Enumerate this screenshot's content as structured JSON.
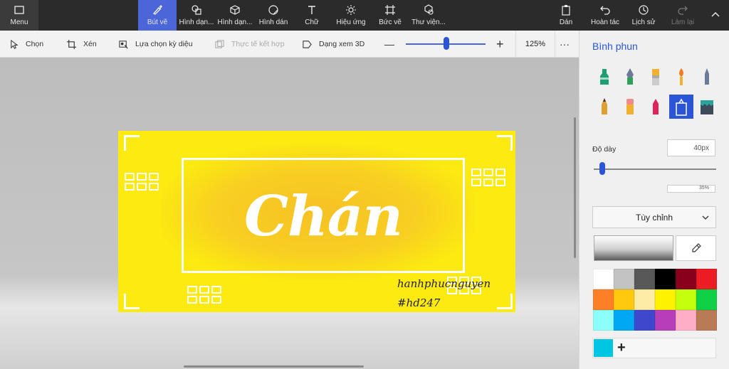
{
  "topbar": {
    "menu_label": "Menu",
    "tools": [
      {
        "label": "Bút vẽ"
      },
      {
        "label": "Hình dạn..."
      },
      {
        "label": "Hình dạn..."
      },
      {
        "label": "Hình dán"
      },
      {
        "label": "Chữ"
      },
      {
        "label": "Hiệu ứng"
      },
      {
        "label": "Bức vẽ"
      },
      {
        "label": "Thư viện..."
      }
    ],
    "paste_label": "Dán",
    "undo_label": "Hoàn tác",
    "history_label": "Lịch sử",
    "redo_label": "Làm lại",
    "active_color": "#4a66d8"
  },
  "toolbar2": {
    "select_label": "Chọn",
    "crop_label": "Xén",
    "magic_select_label": "Lựa chọn kỳ diệu",
    "mixed_reality_label": "Thực tế kết hợp",
    "view3d_label": "Dạng xem 3D",
    "zoom_minus": "—",
    "zoom_plus": "+",
    "zoom_value": "125%",
    "zoom_level_fraction": 0.5,
    "more_label": "···"
  },
  "artwork": {
    "title": "Chán",
    "signature_name": "hanhphucnguyen",
    "signature_tag": "#hd247",
    "background_color": "#fcea10"
  },
  "panel": {
    "title": "Bình phun",
    "brushes": [
      {
        "icon": "marker-icon",
        "color": "#1e9e74"
      },
      {
        "icon": "calligraphy-pen-icon",
        "color": "#2fa05a"
      },
      {
        "icon": "oil-brush-icon",
        "color": "#f0b030"
      },
      {
        "icon": "watercolor-brush-icon",
        "color": "#f07b20"
      },
      {
        "icon": "pixel-pen-icon",
        "color": "#6b7a99"
      },
      {
        "icon": "pencil-icon",
        "color": "#e0a030"
      },
      {
        "icon": "eraser-icon",
        "color": "#f08a8a"
      },
      {
        "icon": "crayon-icon",
        "color": "#e0245a"
      },
      {
        "icon": "spray-can-icon",
        "color": "#2b55d6"
      },
      {
        "icon": "fill-bucket-icon",
        "color": "#2aa39a"
      }
    ],
    "thickness_label": "Độ dày",
    "thickness_value": "40px",
    "opacity_value": "35%",
    "thickness_level_fraction": 0.05,
    "dropdown_label": "Tùy chỉnh",
    "palette": [
      "#ffffff",
      "#c3c3c3",
      "#585858",
      "#000000",
      "#88001b",
      "#ec1c24",
      "#ff7f27",
      "#ffc90e",
      "#fdeca6",
      "#fff200",
      "#c4ff0e",
      "#0ed145",
      "#8cfffb",
      "#00a8f3",
      "#3f48cc",
      "#b83dba",
      "#ffaec8",
      "#b97a56"
    ],
    "custom_color": "#00c5e3",
    "add_color_label": "+"
  }
}
